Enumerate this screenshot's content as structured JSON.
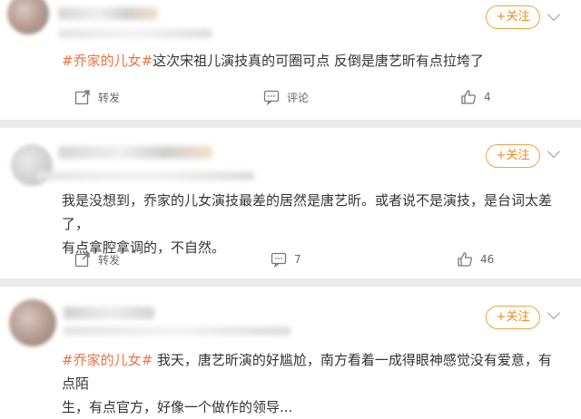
{
  "posts": [
    {
      "follow_label": "+关注",
      "hashtag": "#乔家的儿女#",
      "text": "这次宋祖儿演技真的可圈可点 反倒是唐艺昕有点拉垮了",
      "repost_label": "转发",
      "comment_label": "评论",
      "like_count": "4"
    },
    {
      "follow_label": "+关注",
      "text_line1": "我是没想到，乔家的儿女演技最差的居然是唐艺昕。或者说不是演技，是台词太差了，",
      "text_line2": "有点拿腔拿调的，不自然。",
      "repost_label": "转发",
      "comment_count": "7",
      "like_count": "46"
    },
    {
      "follow_label": "+关注",
      "hashtag": "#乔家的儿女#",
      "text_line1": " 我天，唐艺昕演的好尴尬，南方看着一成得眼神感觉没有爱意，有点陌",
      "text_line2": "生，有点官方，好像一个做作的领导..."
    }
  ],
  "colors": {
    "accent": "#eb7340",
    "follow": "#f08a1d",
    "divider": "#ebebeb"
  },
  "icons": [
    "share-icon",
    "comment-icon",
    "like-icon",
    "chevron-down-icon"
  ]
}
